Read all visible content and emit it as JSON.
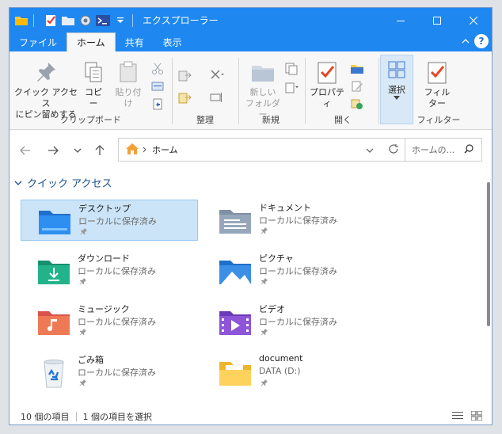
{
  "window": {
    "title": "エクスプローラー"
  },
  "tabs": [
    {
      "label": "ファイル"
    },
    {
      "label": "ホーム"
    },
    {
      "label": "共有"
    },
    {
      "label": "表示"
    }
  ],
  "ribbon": {
    "clipboard": {
      "pin_line1": "クイック アクセス",
      "pin_line2": "にピン留めする",
      "copy": "コピー",
      "paste": "貼り付け",
      "label": "クリップボード"
    },
    "organize": {
      "label": "整理"
    },
    "new": {
      "new_folder_line1": "新しい",
      "new_folder_line2": "フォルダー",
      "label": "新規"
    },
    "open": {
      "properties": "プロパティ",
      "label": "開く"
    },
    "select": {
      "select": "選択"
    },
    "filter": {
      "filter_line1": "フィル",
      "filter_line2": "ター",
      "label": "フィルター"
    }
  },
  "address": {
    "breadcrumb": "ホーム"
  },
  "search": {
    "placeholder": "ホームの..."
  },
  "quick_access": {
    "header": "クイック アクセス",
    "items": [
      {
        "name": "デスクトップ",
        "sub": "ローカルに保存済み"
      },
      {
        "name": "ドキュメント",
        "sub": "ローカルに保存済み"
      },
      {
        "name": "ダウンロード",
        "sub": "ローカルに保存済み"
      },
      {
        "name": "ピクチャ",
        "sub": "ローカルに保存済み"
      },
      {
        "name": "ミュージック",
        "sub": "ローカルに保存済み"
      },
      {
        "name": "ビデオ",
        "sub": "ローカルに保存済み"
      },
      {
        "name": "ごみ箱",
        "sub": "ローカルに保存済み"
      },
      {
        "name": "document",
        "sub": "DATA (D:)"
      }
    ]
  },
  "status": {
    "item_count": "10 個の項目",
    "selected_count": "1 個の項目を選択"
  },
  "colors": {
    "accent": "#1e88f0",
    "selection": "#cce4f7"
  }
}
